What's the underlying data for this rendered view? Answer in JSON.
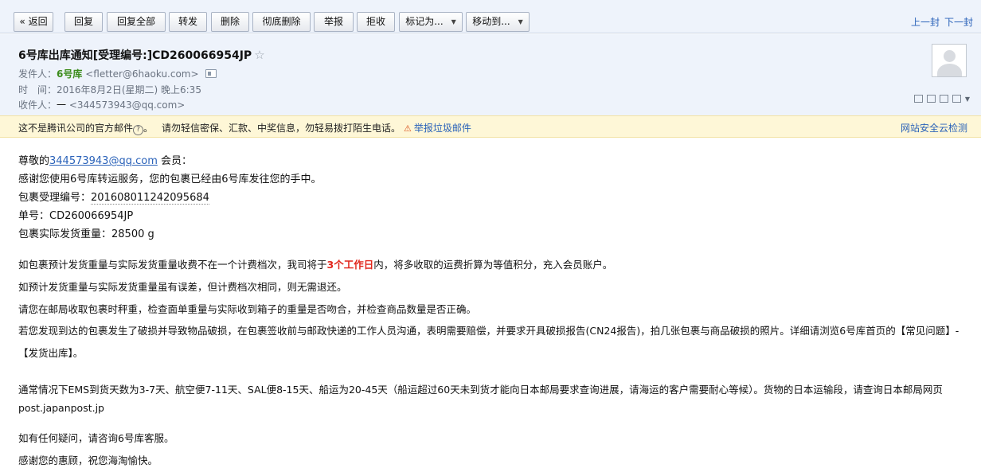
{
  "toolbar": {
    "back": "« 返回",
    "reply": "回复",
    "reply_all": "回复全部",
    "forward": "转发",
    "delete": "删除",
    "delete_permanent": "彻底删除",
    "report": "举报",
    "reject": "拒收",
    "mark_as": "标记为...",
    "move_to": "移动到...",
    "prev": "上一封",
    "next": "下一封"
  },
  "header": {
    "subject": "6号库出库通知[受理编号:]CD260066954JP",
    "from_label": "发件人：",
    "from_name": "6号库",
    "from_email": "<fletter@6haoku.com>",
    "time_label": "时　间：",
    "time_value": "2016年8月2日(星期二) 晚上6:35",
    "to_label": "收件人：",
    "to_name": "一",
    "to_email": "<344573943@qq.com>"
  },
  "warning": {
    "not_official": "这不是腾讯公司的官方邮件",
    "caution": "请勿轻信密保、汇款、中奖信息，勿轻易拨打陌生电话。",
    "report_spam": "举报垃圾邮件",
    "cloud_check": "网站安全云检测"
  },
  "body": {
    "greet_pre": "尊敬的",
    "greet_email": "344573943@qq.com",
    "greet_post": " 会员：",
    "thanks": "感谢您使用6号库转运服务，您的包裹已经由6号库发往您的手中。",
    "pkg_no_label": "包裹受理编号：",
    "pkg_no": "201608011242095684",
    "tracking_label": "单号：",
    "tracking": "CD260066954JP",
    "weight_label": "包裹实际发货重量：",
    "weight": "28500 g",
    "p1_pre": "如包裹预计发货重量与实际发货重量收费不在一个计费档次，我司将于",
    "p1_red": "3个工作日",
    "p1_post": "内，将多收取的运费折算为等值积分，充入会员账户。",
    "p2": "如预计发货重量与实际发货重量虽有误差，但计费档次相同，则无需退还。",
    "p3": "请您在邮局收取包裹时秤重，检查面单重量与实际收到箱子的重量是否吻合，并检查商品数量是否正确。",
    "p4": "若您发现到达的包裹发生了破损并导致物品破损，在包裹签收前与邮政快递的工作人员沟通，表明需要赔偿，并要求开具破损报告(CN24报告)，拍几张包裹与商品破损的照片。详细请浏览6号库首页的【常见问题】-【发货出库】。",
    "p5": "通常情况下EMS到货天数为3-7天、航空便7-11天、SAL便8-15天、船运为20-45天（船运超过60天未到货才能向日本邮局要求查询进展，请海运的客户需要耐心等候）。货物的日本运输段，请查询日本邮局网页 post.japanpost.jp",
    "p6": "如有任何疑问，请咨询6号库客服。",
    "p7": "感谢您的惠顾，祝您海淘愉快。"
  },
  "colors": {
    "toolbar_bg": "#eef3fb",
    "link": "#2a62b9",
    "sender": "#3c8c1c",
    "highlight_red": "#e1261c",
    "warning_bg": "#fef7d7"
  }
}
